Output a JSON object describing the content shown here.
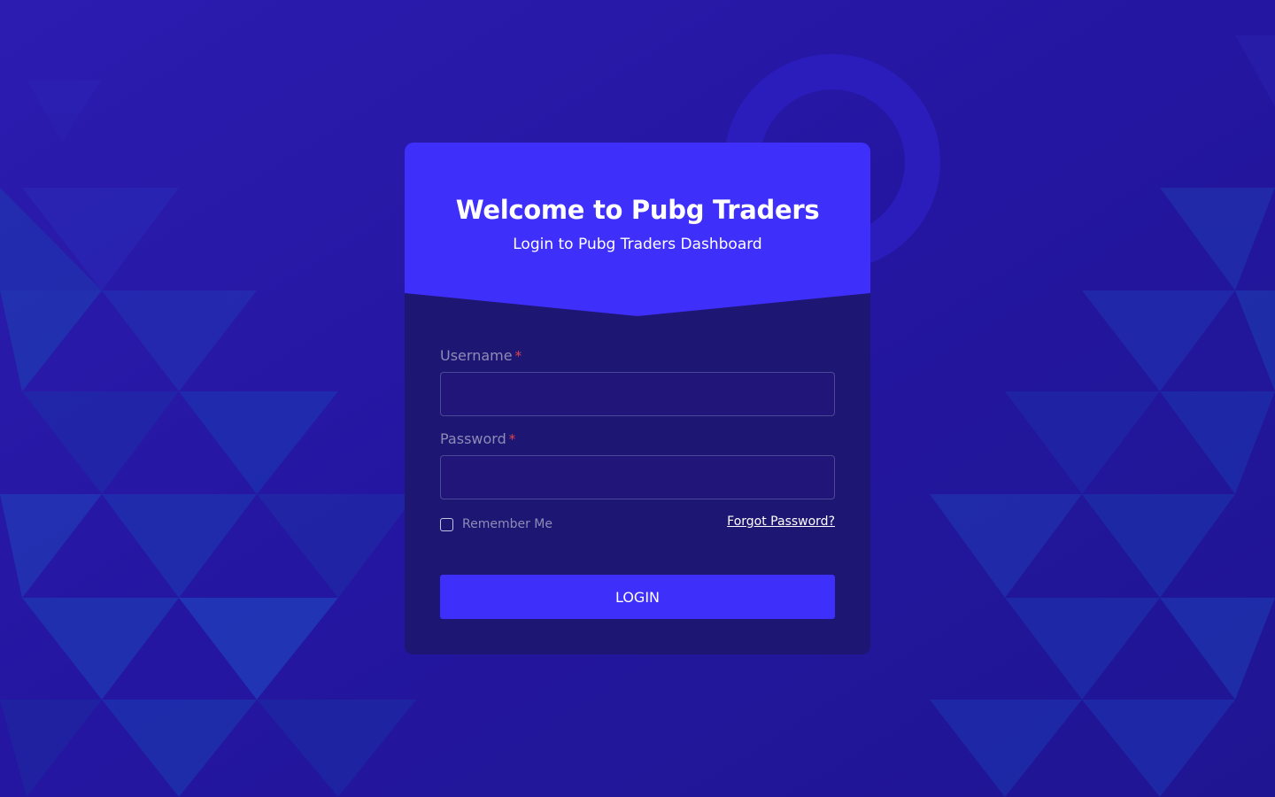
{
  "login_card": {
    "title": "Welcome to Pubg Traders",
    "subtitle": "Login to Pubg Traders Dashboard",
    "username": {
      "label": "Username",
      "required_marker": "*",
      "value": "",
      "placeholder": ""
    },
    "password": {
      "label": "Password",
      "required_marker": "*",
      "value": "",
      "placeholder": ""
    },
    "remember_me": {
      "label": "Remember Me",
      "checked": false
    },
    "forgot_password_label": "Forgot Password?",
    "login_button_label": "LOGIN"
  },
  "colors": {
    "background": "#24189e",
    "card_body": "#1d1672",
    "card_header": "#3f2ffa",
    "accent": "#3f2ffa",
    "required": "#e0434f"
  }
}
